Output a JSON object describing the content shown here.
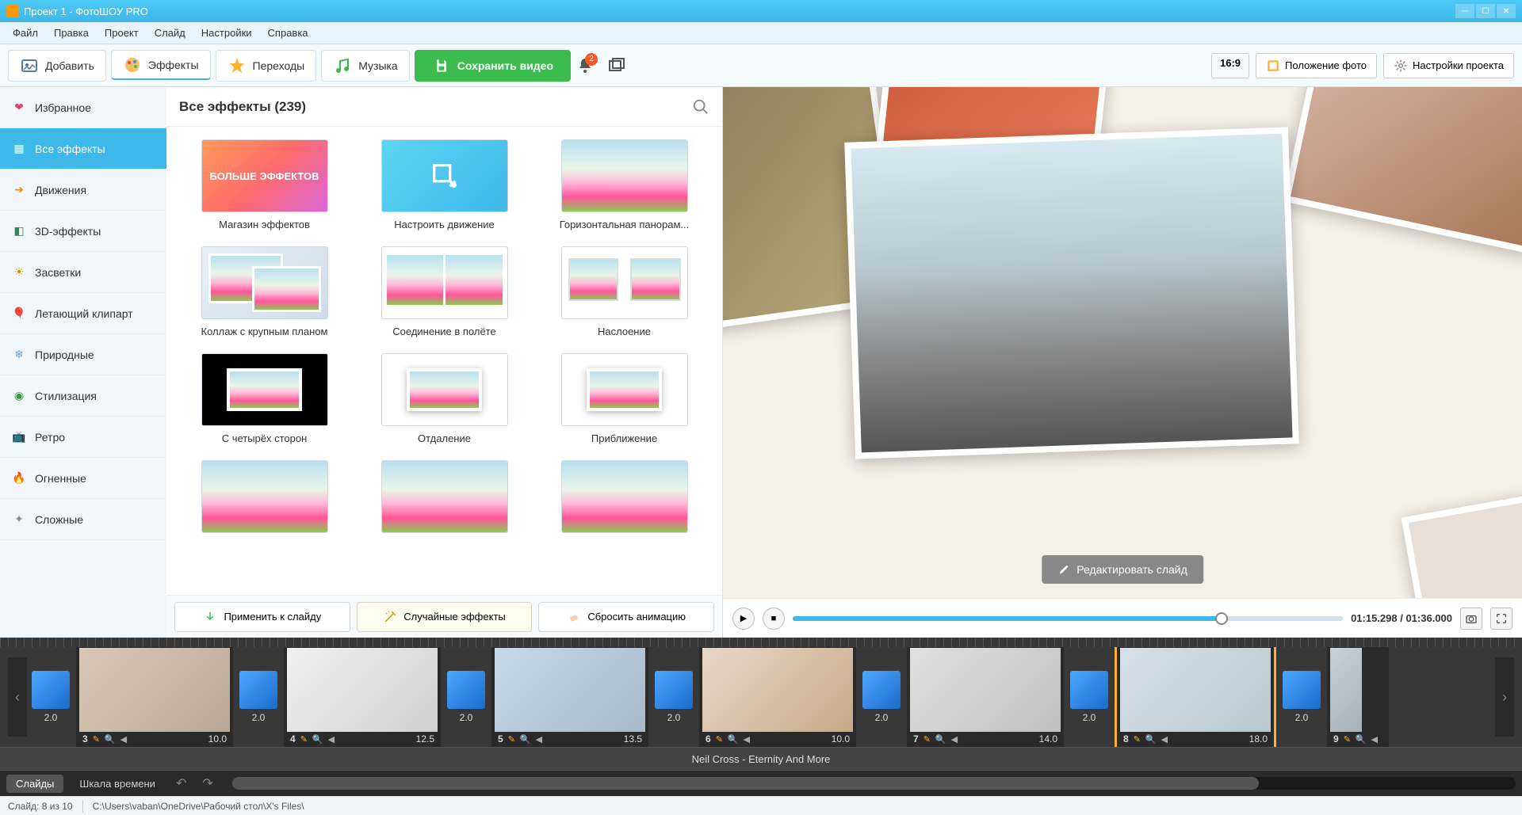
{
  "window": {
    "title": "Проект 1 - ФотоШОУ PRO"
  },
  "menu": [
    "Файл",
    "Правка",
    "Проект",
    "Слайд",
    "Настройки",
    "Справка"
  ],
  "toolbar": {
    "add": "Добавить",
    "effects": "Эффекты",
    "transitions": "Переходы",
    "music": "Музыка",
    "save": "Сохранить видео",
    "notifications_count": "2",
    "aspect": "16:9",
    "position": "Положение фото",
    "settings": "Настройки проекта"
  },
  "categories": [
    {
      "icon": "heart",
      "label": "Избранное",
      "color": "#e04570"
    },
    {
      "icon": "grid",
      "label": "Все эффекты",
      "color": "#fff",
      "active": true
    },
    {
      "icon": "arrow",
      "label": "Движения",
      "color": "#ff8800"
    },
    {
      "icon": "cube",
      "label": "3D-эффекты",
      "color": "#2a8a5a"
    },
    {
      "icon": "sun",
      "label": "Засветки",
      "color": "#cc9900"
    },
    {
      "icon": "balloon",
      "label": "Летающий клипарт",
      "color": "#cc3366"
    },
    {
      "icon": "snowflake",
      "label": "Природные",
      "color": "#5aaadd"
    },
    {
      "icon": "circle",
      "label": "Стилизация",
      "color": "#339933"
    },
    {
      "icon": "tv",
      "label": "Ретро",
      "color": "#aa6633"
    },
    {
      "icon": "fire",
      "label": "Огненные",
      "color": "#ee5522"
    },
    {
      "icon": "complex",
      "label": "Сложные",
      "color": "#888"
    }
  ],
  "effects_panel": {
    "title": "Все эффекты (239)",
    "items": [
      {
        "type": "more",
        "label": "Магазин эффектов",
        "text": "БОЛЬШЕ ЭФФЕКТОВ"
      },
      {
        "type": "config",
        "label": "Настроить движение"
      },
      {
        "type": "flower",
        "label": "Горизонтальная панорам..."
      },
      {
        "type": "flower-collage",
        "label": "Коллаж с крупным планом"
      },
      {
        "type": "flower-fly",
        "label": "Соединение в полёте"
      },
      {
        "type": "flower-overlay",
        "label": "Наслоение"
      },
      {
        "type": "flower-dark",
        "label": "С четырёх сторон"
      },
      {
        "type": "flower-small",
        "label": "Отдаление"
      },
      {
        "type": "flower-small",
        "label": "Приближение"
      },
      {
        "type": "flower",
        "label": ""
      },
      {
        "type": "flower",
        "label": ""
      },
      {
        "type": "flower",
        "label": ""
      }
    ],
    "apply": "Применить к слайду",
    "random": "Случайные эффекты",
    "reset": "Сбросить анимацию"
  },
  "preview": {
    "edit": "Редактировать слайд"
  },
  "player": {
    "time": "01:15.298 / 01:36.000"
  },
  "timeline": {
    "transitions": [
      "2.0",
      "2.0",
      "2.0",
      "2.0",
      "2.0",
      "2.0",
      "2.0",
      "2.0"
    ],
    "slides": [
      {
        "num": "3",
        "dur": "10.0"
      },
      {
        "num": "4",
        "dur": "12.5"
      },
      {
        "num": "5",
        "dur": "13.5"
      },
      {
        "num": "6",
        "dur": "10.0"
      },
      {
        "num": "7",
        "dur": "14.0"
      },
      {
        "num": "8",
        "dur": "18.0",
        "active": true
      },
      {
        "num": "9",
        "dur": ""
      }
    ],
    "audio": "Neil Cross - Eternity And More"
  },
  "view_tabs": {
    "slides": "Слайды",
    "timeline": "Шкала времени"
  },
  "status": {
    "slide": "Слайд: 8 из 10",
    "path": "C:\\Users\\vaban\\OneDrive\\Рабочий стол\\X's Files\\"
  }
}
